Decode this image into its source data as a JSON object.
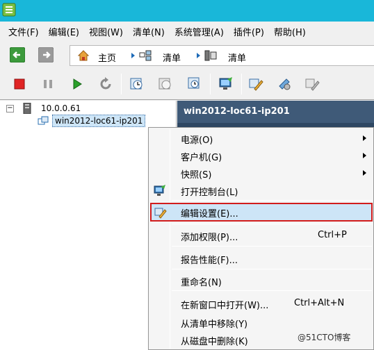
{
  "menubar": {
    "items": [
      "文件(F)",
      "编辑(E)",
      "视图(W)",
      "清单(N)",
      "系统管理(A)",
      "插件(P)",
      "帮助(H)"
    ]
  },
  "nav": {
    "breadcrumbs": [
      "主页",
      "清单",
      "清单"
    ]
  },
  "tree": {
    "host": "10.0.0.61",
    "vm": "win2012-loc61-ip201"
  },
  "panel": {
    "title": "win2012-loc61-ip201"
  },
  "context_menu": {
    "items": [
      {
        "label": "电源(O)",
        "submenu": true
      },
      {
        "label": "客户机(G)",
        "submenu": true
      },
      {
        "label": "快照(S)",
        "submenu": true
      },
      {
        "label": "打开控制台(L)",
        "icon": "console-icon"
      },
      {
        "label": "编辑设置(E)...",
        "icon": "edit-settings-icon",
        "highlighted": true
      },
      {
        "label": "添加权限(P)...",
        "shortcut": "Ctrl+P"
      },
      {
        "label": "报告性能(F)..."
      },
      {
        "label": "重命名(N)"
      },
      {
        "label": "在新窗口中打开(W)...",
        "shortcut": "Ctrl+Alt+N"
      },
      {
        "label": "从清单中移除(Y)"
      },
      {
        "label": "从磁盘中删除(K)"
      }
    ]
  },
  "watermark": "@51CTO博客",
  "colors": {
    "titlebar": "#19b7d9",
    "vm_header": "#3f5a78",
    "highlight_fill": "#cde5f7",
    "highlight_border": "#d21c1c"
  }
}
